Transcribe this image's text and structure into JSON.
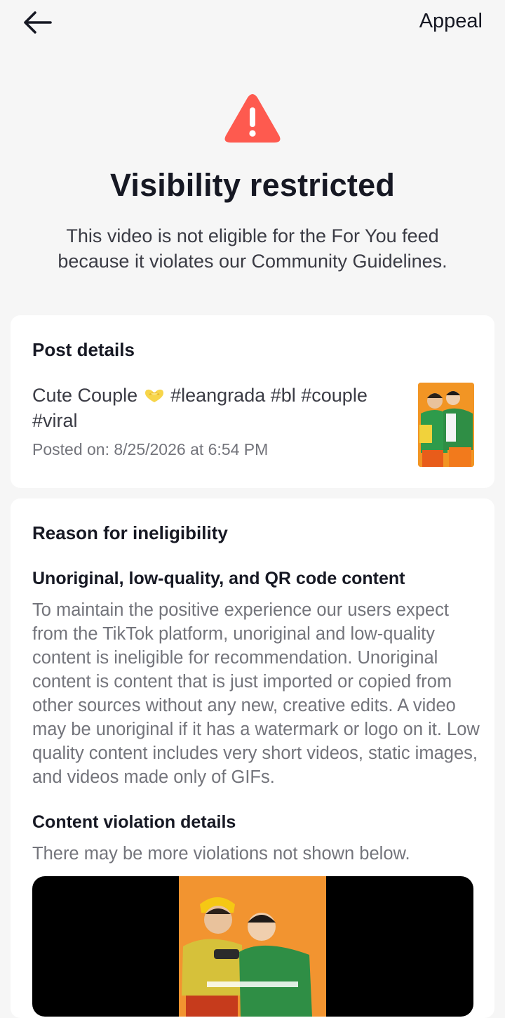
{
  "header": {
    "back_icon": "arrow-left-icon",
    "appeal_label": "Appeal"
  },
  "status": {
    "icon": "warning-triangle-icon",
    "icon_color": "#fe5a4f",
    "title": "Visibility restricted",
    "description": "This video is not eligible for the For You feed because it violates our Community Guidelines."
  },
  "post_details": {
    "heading": "Post details",
    "caption_before_emoji": "Cute Couple ",
    "caption_emoji": "heart-hands-emoji",
    "caption_after_emoji": " #leangrada #bl #couple #viral",
    "posted_on": "Posted on: 8/25/2026 at 6:54 PM"
  },
  "reason": {
    "heading": "Reason for ineligibility",
    "category": "Unoriginal, low-quality, and QR code content",
    "explanation": "To maintain the positive experience our users expect from the TikTok platform, unoriginal and low-quality content is ineligible for recommendation. Unoriginal content is content that is just imported or copied from other sources without any new, creative edits. A video may be unoriginal if it has a watermark or logo on it. Low quality content includes very short videos, static images, and videos made only of GIFs.",
    "violation_heading": "Content violation details",
    "violation_note": "There may be more violations not shown below."
  }
}
